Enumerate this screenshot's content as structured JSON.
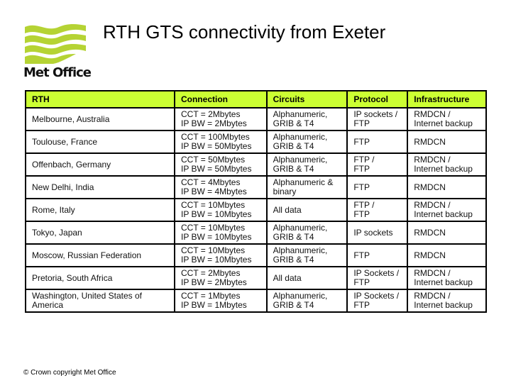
{
  "header": {
    "logo_text": "Met Office",
    "title": "RTH GTS connectivity from Exeter"
  },
  "colors": {
    "header_bg": "#ccff33",
    "logo_green": "#b5d334"
  },
  "table": {
    "columns": [
      "RTH",
      "Connection",
      "Circuits",
      "Protocol",
      "Infrastructure"
    ],
    "rows": [
      {
        "rth": [
          "Melbourne, Australia"
        ],
        "connection": [
          "CCT = 2Mbytes",
          "IP BW = 2Mbytes"
        ],
        "circuits": [
          "Alphanumeric,",
          "GRIB & T4"
        ],
        "protocol": [
          "IP sockets /",
          "FTP"
        ],
        "infrastructure": [
          "RMDCN /",
          "Internet backup"
        ]
      },
      {
        "rth": [
          "Toulouse, France"
        ],
        "connection": [
          "CCT = 100Mbytes",
          "IP BW = 50Mbytes"
        ],
        "circuits": [
          "Alphanumeric,",
          "GRIB & T4"
        ],
        "protocol": [
          "FTP"
        ],
        "infrastructure": [
          "RMDCN"
        ]
      },
      {
        "rth": [
          "Offenbach, Germany"
        ],
        "connection": [
          "CCT = 50Mbytes",
          "IP BW = 50Mbytes"
        ],
        "circuits": [
          "Alphanumeric,",
          "GRIB & T4"
        ],
        "protocol": [
          "FTP /",
          "FTP"
        ],
        "infrastructure": [
          "RMDCN /",
          "Internet backup"
        ]
      },
      {
        "rth": [
          "New Delhi, India"
        ],
        "connection": [
          "CCT = 4Mbytes",
          "IP BW = 4Mbytes"
        ],
        "circuits": [
          "Alphanumeric &",
          "binary"
        ],
        "protocol": [
          "FTP"
        ],
        "infrastructure": [
          "RMDCN"
        ]
      },
      {
        "rth": [
          "Rome, Italy"
        ],
        "connection": [
          "CCT = 10Mbytes",
          "IP BW = 10Mbytes"
        ],
        "circuits": [
          "All data"
        ],
        "protocol": [
          "FTP /",
          "FTP"
        ],
        "infrastructure": [
          "RMDCN /",
          "Internet backup"
        ]
      },
      {
        "rth": [
          "Tokyo, Japan"
        ],
        "connection": [
          "CCT = 10Mbytes",
          "IP BW = 10Mbytes"
        ],
        "circuits": [
          "Alphanumeric,",
          "GRIB & T4"
        ],
        "protocol": [
          "IP sockets"
        ],
        "infrastructure": [
          "RMDCN"
        ]
      },
      {
        "rth": [
          "Moscow, Russian Federation"
        ],
        "connection": [
          "CCT = 10Mbytes",
          "IP BW = 10Mbytes"
        ],
        "circuits": [
          "Alphanumeric,",
          "GRIB & T4"
        ],
        "protocol": [
          "FTP"
        ],
        "infrastructure": [
          "RMDCN"
        ]
      },
      {
        "rth": [
          "Pretoria, South Africa"
        ],
        "connection": [
          "CCT = 2Mbytes",
          "IP BW = 2Mbytes"
        ],
        "circuits": [
          "All data"
        ],
        "protocol": [
          "IP Sockets /",
          "FTP"
        ],
        "infrastructure": [
          "RMDCN /",
          "Internet backup"
        ]
      },
      {
        "rth": [
          "Washington, United States of",
          "America"
        ],
        "connection": [
          "CCT = 1Mbytes",
          "IP BW = 1Mbytes"
        ],
        "circuits": [
          "Alphanumeric,",
          "GRIB & T4"
        ],
        "protocol": [
          "IP Sockets /",
          "FTP"
        ],
        "infrastructure": [
          "RMDCN /",
          "Internet backup"
        ]
      }
    ]
  },
  "footer": {
    "copyright": "© Crown copyright   Met Office"
  }
}
